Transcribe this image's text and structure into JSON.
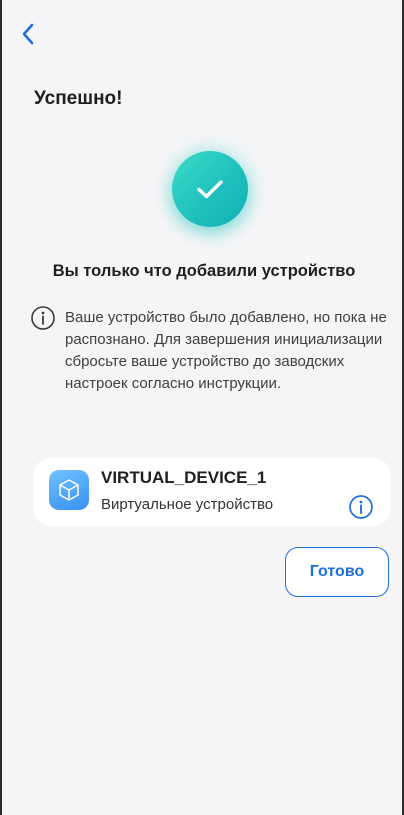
{
  "header": {
    "back_icon": "chevron-left-icon",
    "title": "Успешно!"
  },
  "success": {
    "icon": "checkmark-icon",
    "colors": {
      "start": "#3cdcc8",
      "end": "#12aeb6"
    }
  },
  "headline": "Вы только что добавили устройство",
  "info": {
    "icon": "info-icon",
    "text": "Ваше устройство было добавлено, но пока не распознано. Для завершения инициализации сбросьте ваше устройство до заводских настроек согласно инструкции."
  },
  "device": {
    "icon": "cube-icon",
    "name": "VIRTUAL_DEVICE_1",
    "type": "Виртуальное устройство",
    "info_icon": "info-icon"
  },
  "actions": {
    "done_label": "Готово"
  },
  "theme": {
    "accent": "#1e6fd9",
    "background": "#f5f5f7",
    "card": "#ffffff"
  }
}
